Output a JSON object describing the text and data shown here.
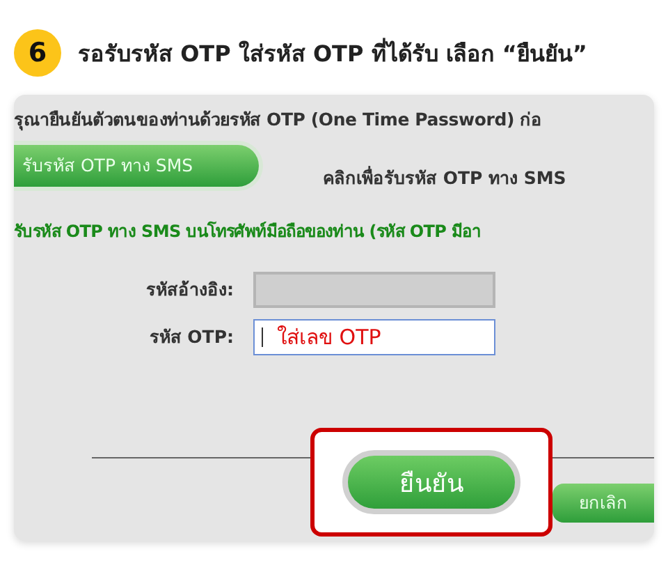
{
  "step": {
    "number": "6",
    "title": "รอรับรหัส OTP ใส่รหัส OTP ที่ได้รับ เลือก “ยืนยัน”"
  },
  "form": {
    "intro": "รุณายืนยันตัวตนของท่านด้วยรหัส OTP (One Time Password) ก่อ",
    "sms_button": "รับรหัส OTP ทาง SMS",
    "sms_hint": "คลิกเพื่อรับรหัส OTP ทาง SMS",
    "notice": "รับรหัส OTP ทาง SMS บนโทรศัพท์มือถือของท่าน (รหัส OTP มีอา",
    "fields": [
      {
        "label": "รหัสอ้างอิง:",
        "disabled": true
      },
      {
        "label": "รหัส OTP:",
        "disabled": false,
        "value": "ใส่เลข OTP"
      }
    ],
    "buttons": [
      {
        "label": "ยืนยัน",
        "highlighted": true
      },
      {
        "label": "ยกเลิก",
        "highlighted": false
      }
    ]
  }
}
